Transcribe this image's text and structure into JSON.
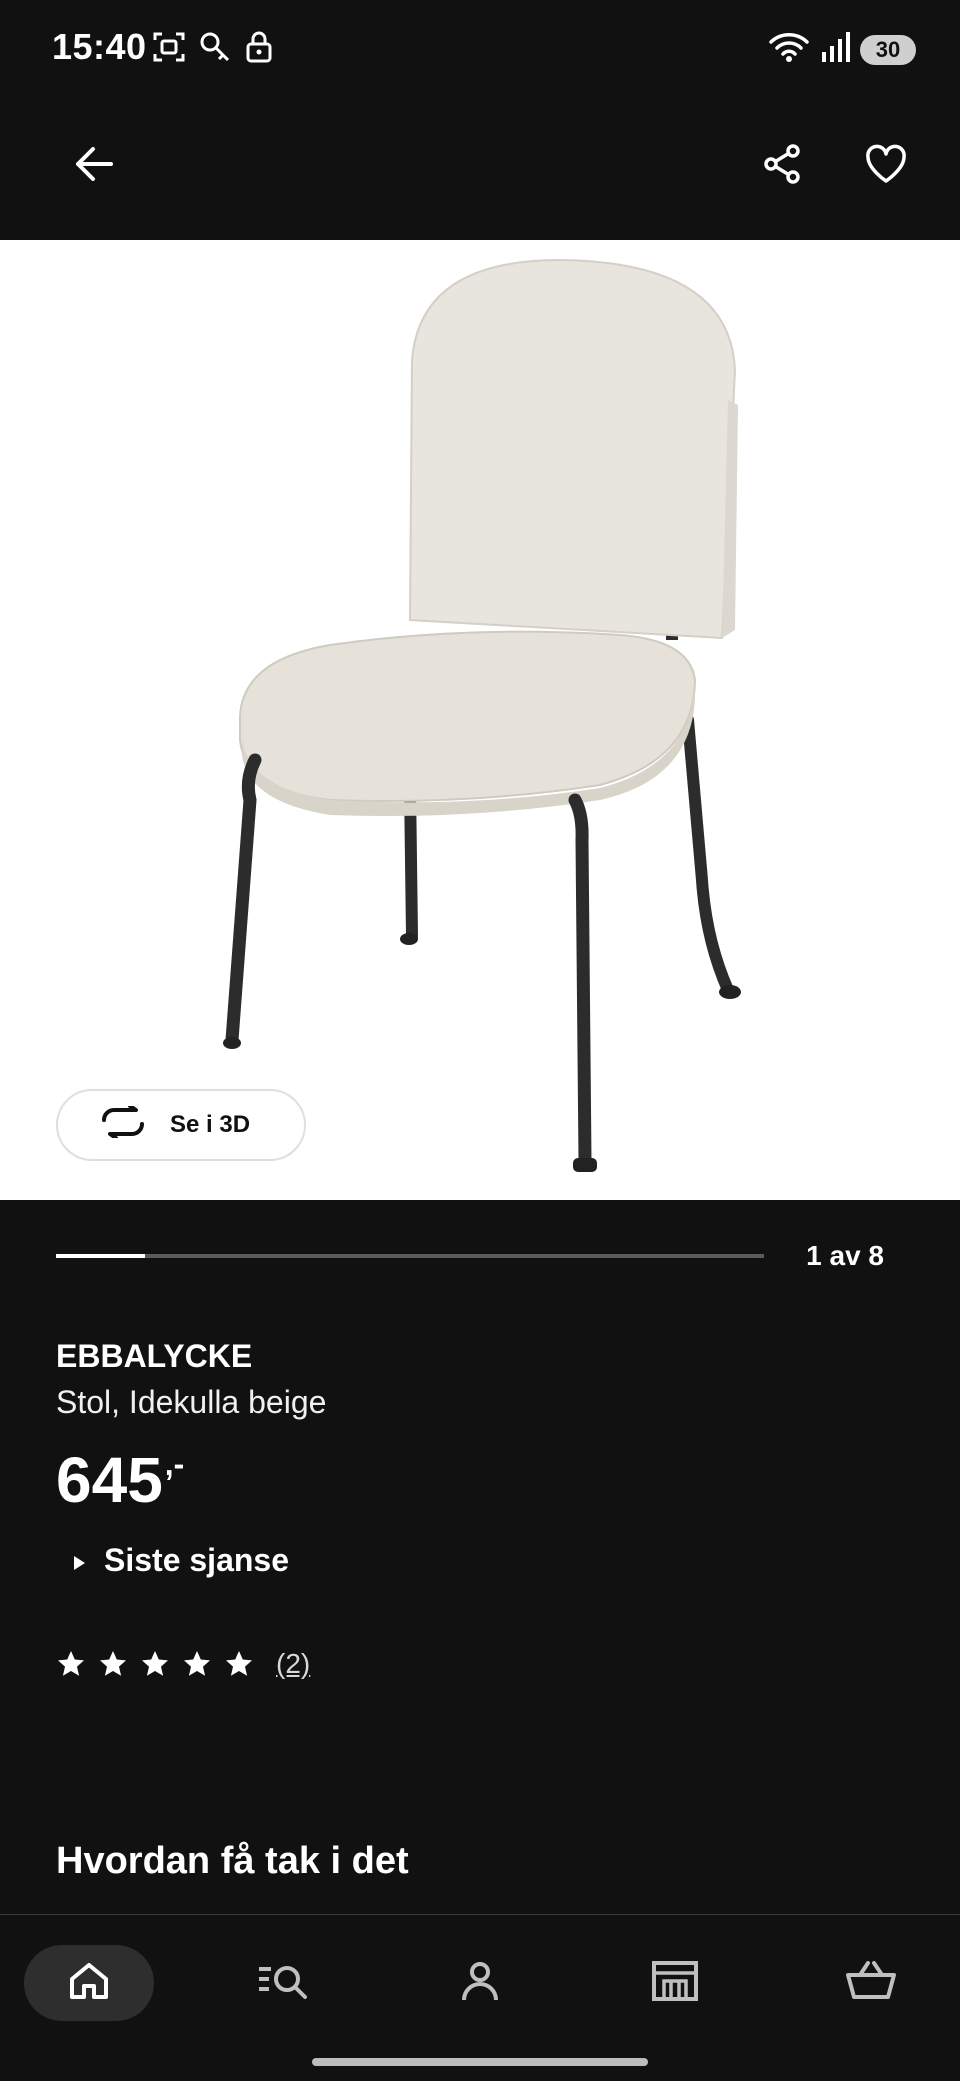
{
  "status_bar": {
    "time": "15:40",
    "battery": "30",
    "icons_left": [
      "screenshot-icon",
      "search-key-icon",
      "lock-icon"
    ],
    "icons_right": [
      "wifi-icon",
      "signal-icon",
      "battery-icon"
    ]
  },
  "top_bar": {
    "icons": [
      "back-arrow-icon",
      "share-icon",
      "heart-icon"
    ]
  },
  "hero": {
    "view_3d_label": "Se i 3D",
    "image_index": 1,
    "image_total": 8,
    "page_indicator": "1 av 8",
    "progress_fraction": 0.125
  },
  "product": {
    "name": "EBBALYCKE",
    "description": "Stol, Idekulla beige",
    "price": "645",
    "price_suffix": ",-",
    "badge": "Siste sjanse",
    "rating_stars": 5,
    "review_count": "(2)"
  },
  "section": {
    "title": "Hvordan få tak i det"
  },
  "bottom_nav": {
    "items": [
      "home-icon",
      "browse-icon",
      "account-icon",
      "store-icon",
      "basket-icon"
    ],
    "active": "home-icon"
  },
  "colors": {
    "background": "#111111",
    "text": "#ffffff",
    "hero_background": "#ffffff",
    "progress_track": "#5a5a5a"
  }
}
